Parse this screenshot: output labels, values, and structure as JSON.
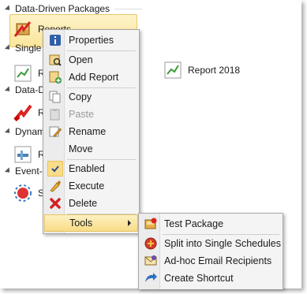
{
  "sections": [
    {
      "label": "Data-Driven Packages"
    },
    {
      "label": "Single"
    },
    {
      "label": "Data-D"
    },
    {
      "label": "Dynam"
    },
    {
      "label": "Event-"
    }
  ],
  "tiles": {
    "reports_selected": "Reports",
    "report_2018": "Report 2018",
    "single_item": "R",
    "dd_item": "R",
    "dyn_item": "R",
    "event_item": "S"
  },
  "context_menu": {
    "items": [
      {
        "label": "Properties",
        "icon": "info-icon"
      },
      {
        "label": "Open",
        "icon": "open-icon"
      },
      {
        "label": "Add Report",
        "icon": "add-report-icon"
      },
      {
        "label": "Copy",
        "icon": "copy-icon"
      },
      {
        "label": "Paste",
        "icon": "paste-icon"
      },
      {
        "label": "Rename",
        "icon": "rename-icon"
      },
      {
        "label": "Move",
        "icon": ""
      },
      {
        "label": "Enabled",
        "icon": "checkmark-icon"
      },
      {
        "label": "Execute",
        "icon": "execute-icon"
      },
      {
        "label": "Delete",
        "icon": "delete-icon"
      },
      {
        "label": "Tools",
        "icon": ""
      }
    ]
  },
  "tools_submenu": {
    "items": [
      {
        "label": "Test Package",
        "icon": "test-package-icon"
      },
      {
        "label": "Split into Single Schedules",
        "icon": "split-icon"
      },
      {
        "label": "Ad-hoc Email Recipients",
        "icon": "email-icon"
      },
      {
        "label": "Create Shortcut",
        "icon": "shortcut-icon"
      }
    ]
  },
  "colors": {
    "highlight": "#fbe69a",
    "highlight_border": "#e5c365",
    "delete_red": "#d42020"
  }
}
